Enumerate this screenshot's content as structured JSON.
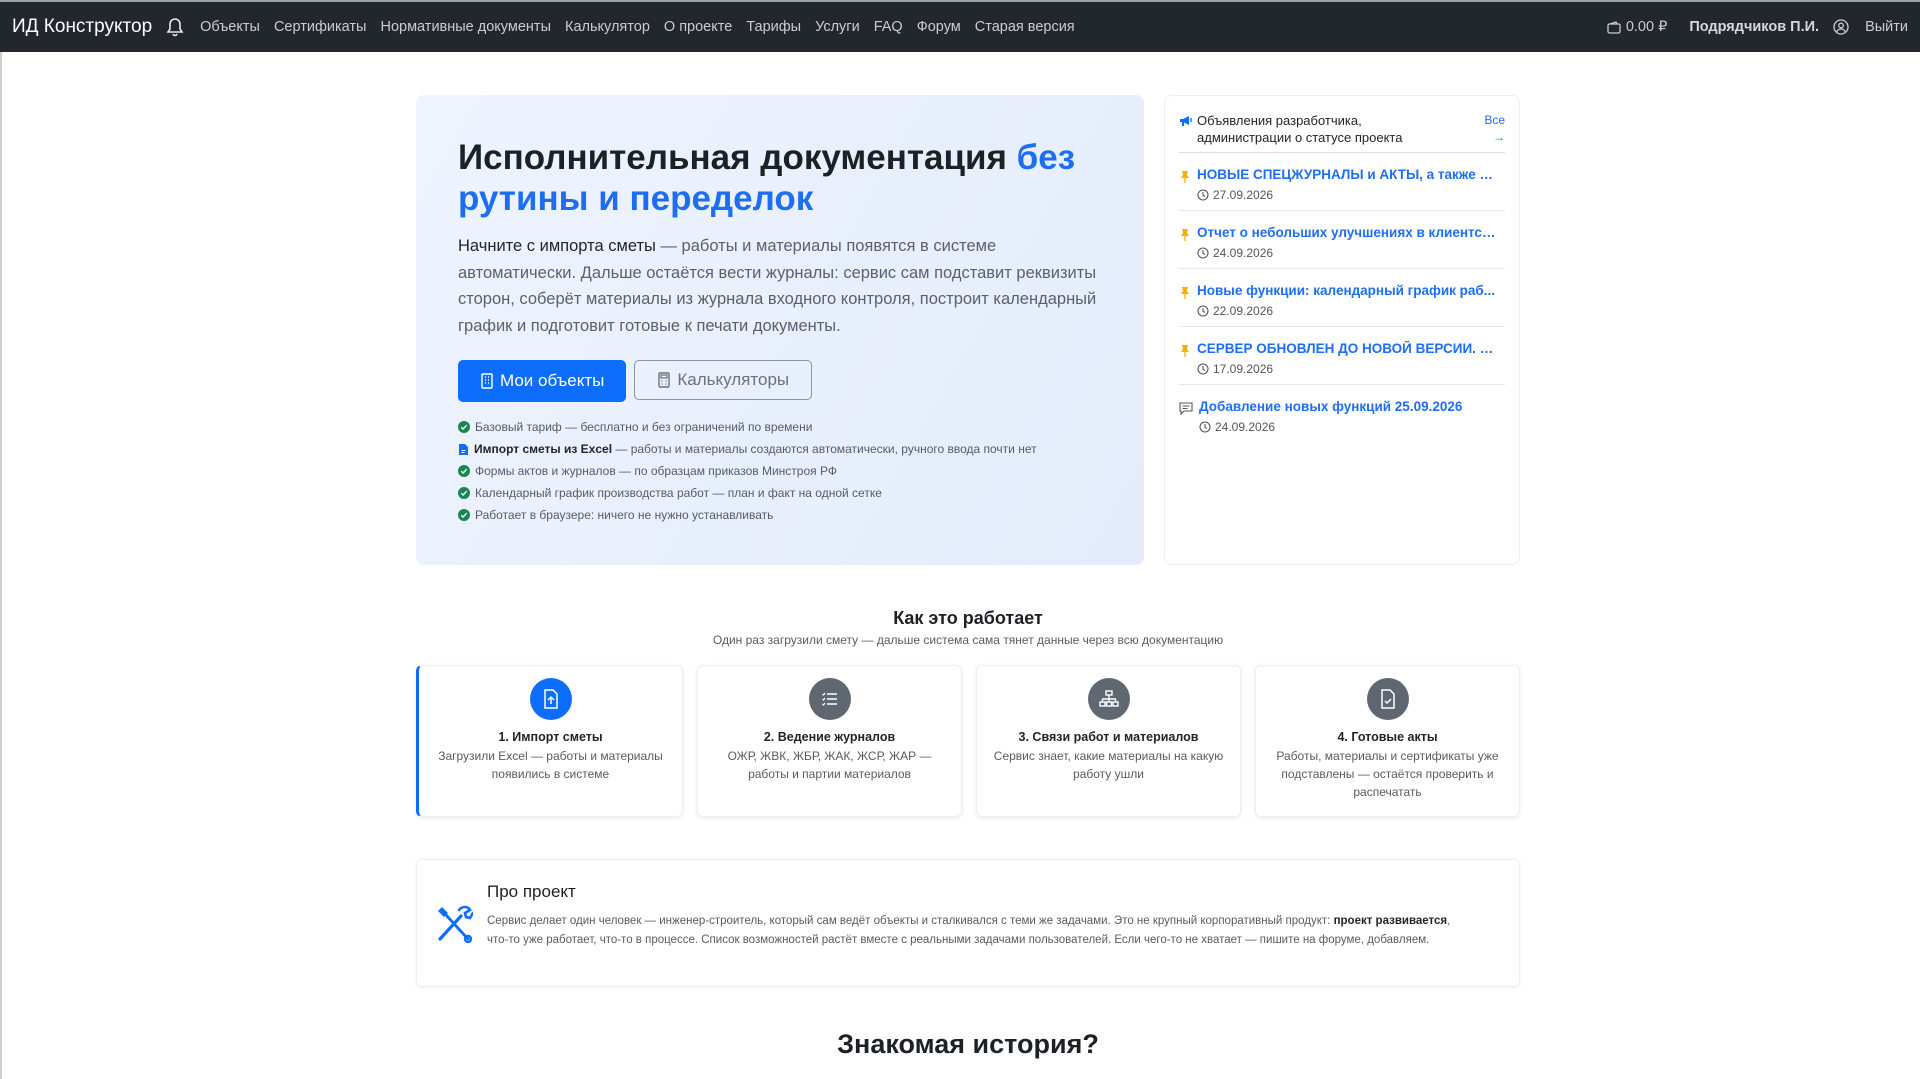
{
  "nav": {
    "brand": "ИД Конструктор",
    "links": [
      "Объекты",
      "Сертификаты",
      "Нормативные документы",
      "Калькулятор",
      "О проекте",
      "Тарифы",
      "Услуги",
      "FAQ",
      "Форум",
      "Старая версия"
    ],
    "balance": "0.00 ₽",
    "user": "Подрядчиков П.И.",
    "logout": "Выйти"
  },
  "hero": {
    "title_main": "Исполнительная документация ",
    "title_accent": "без рутины и переделок",
    "lead_bold": "Начните с импорта сметы",
    "lead_rest": " — работы и материалы появятся в системе автоматически. Дальше остаётся вести журналы: сервис сам подставит реквизиты сторон, соберёт материалы из журнала входного контроля, построит календарный график и подготовит готовые к печати документы.",
    "primary_button": "Мои объекты",
    "secondary_button": "Калькуляторы",
    "features": [
      {
        "bold": "",
        "text": "Базовый тариф — бесплатно и без ограничений по времени",
        "icon": "check-circle-icon"
      },
      {
        "bold": "Импорт сметы из Excel",
        "text": " — работы и материалы создаются автоматически, ручного ввода почти нет",
        "icon": "file-icon"
      },
      {
        "bold": "",
        "text": "Формы актов и журналов — по образцам приказов Минстроя РФ",
        "icon": "check-circle-icon"
      },
      {
        "bold": "",
        "text": "Календарный график производства работ — план и факт на одной сетке",
        "icon": "check-circle-icon"
      },
      {
        "bold": "",
        "text": "Работает в браузере: ничего не нужно устанавливать",
        "icon": "check-circle-icon"
      }
    ]
  },
  "news": {
    "title": "Объявления разработчика, администрации о статусе проекта",
    "all_link": "Все →",
    "items": [
      {
        "title": "НОВЫЕ СПЕЦЖУРНАЛЫ и АКТЫ, а также д...",
        "date": "27.09.2026",
        "icon": "pin-icon"
      },
      {
        "title": "Отчет о небольших улучшениях в клиентск...",
        "date": "24.09.2026",
        "icon": "pin-icon"
      },
      {
        "title": "Новые функции: календарный график раб...",
        "date": "22.09.2026",
        "icon": "pin-icon"
      },
      {
        "title": "СЕРВЕР ОБНОВЛЕН ДО НОВОЙ ВЕРСИИ. ВС...",
        "date": "17.09.2026",
        "icon": "pin-icon"
      },
      {
        "title": "Добавление новых функций 25.09.2026",
        "date": "24.09.2026",
        "icon": "message-icon"
      }
    ]
  },
  "how": {
    "title": "Как это работает",
    "subtitle": "Один раз загрузили смету — дальше система сама тянет данные через всю документацию",
    "steps": [
      {
        "title": "1. Импорт сметы",
        "desc": "Загрузили Excel — работы и материалы появились в системе",
        "icon": "upload-file-icon"
      },
      {
        "title": "2. Ведение журналов",
        "desc": "ОЖР, ЖВК, ЖБР, ЖАК, ЖСР, ЖАР — работы и партии материалов",
        "icon": "list-icon"
      },
      {
        "title": "3. Связи работ и материалов",
        "desc": "Сервис знает, какие материалы на какую работу ушли",
        "icon": "hierarchy-icon"
      },
      {
        "title": "4. Готовые акты",
        "desc": "Работы, материалы и сертификаты уже подставлены — остаётся проверить и распечатать",
        "icon": "file-check-icon"
      }
    ]
  },
  "about": {
    "title": "Про проект",
    "text_1": "Сервис делает один человек — инженер-строитель, который сам ведёт объекты и сталкивался с теми же задачами. Это не крупный корпоративный продукт: ",
    "text_bold": "проект развивается",
    "text_2": ", что-то уже работает, что-то в процессе. Список возможностей растёт вместе с реальными задачами пользователей. Если чего-то не хватает — пишите на форуме, добавляем."
  },
  "story": {
    "title": "Знакомая история?"
  }
}
